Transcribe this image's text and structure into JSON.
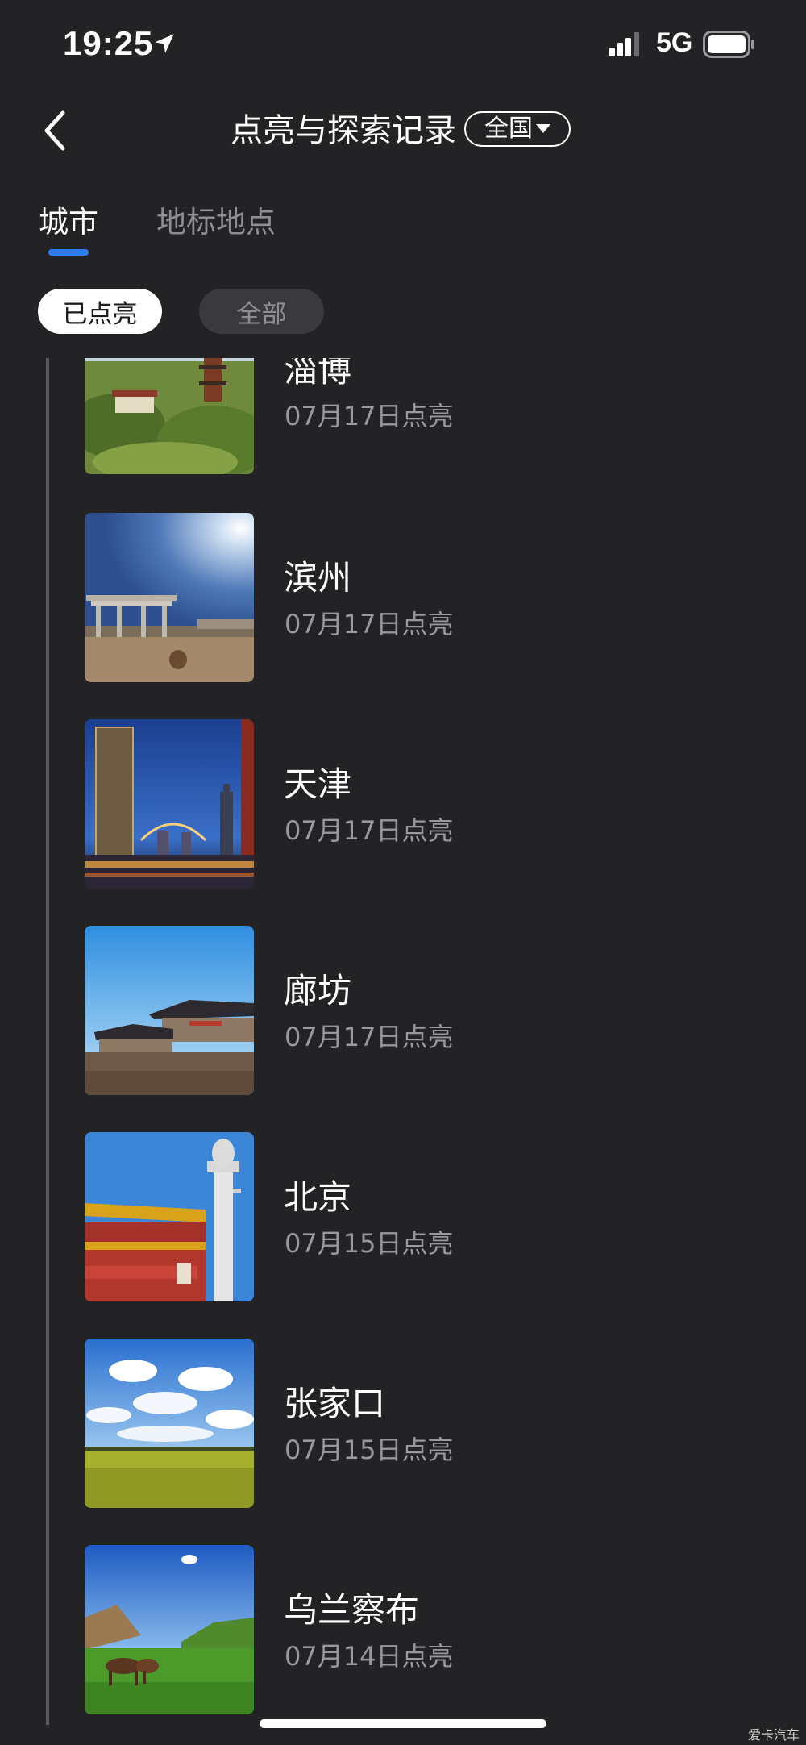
{
  "status_bar": {
    "time": "19:25",
    "network": "5G",
    "icons": [
      "location-arrow-icon",
      "signal-bars-icon",
      "battery-icon"
    ]
  },
  "header": {
    "back_icon": "chevron-left-icon",
    "title": "点亮与探索记录",
    "region_label": "全国"
  },
  "tabs": [
    {
      "label": "城市",
      "active": true
    },
    {
      "label": "地标地点",
      "active": false
    }
  ],
  "filters": [
    {
      "label": "已点亮",
      "selected": true
    },
    {
      "label": "全部",
      "selected": false
    }
  ],
  "cities": [
    {
      "name": "淄博",
      "date": "07月17日点亮"
    },
    {
      "name": "滨州",
      "date": "07月17日点亮"
    },
    {
      "name": "天津",
      "date": "07月17日点亮"
    },
    {
      "name": "廊坊",
      "date": "07月17日点亮"
    },
    {
      "name": "北京",
      "date": "07月15日点亮"
    },
    {
      "name": "张家口",
      "date": "07月15日点亮"
    },
    {
      "name": "乌兰察布",
      "date": "07月14日点亮"
    }
  ],
  "watermark": "爱卡汽车",
  "colors": {
    "background": "#232325",
    "accent": "#2f7cf6",
    "secondary_text": "#98989d"
  }
}
